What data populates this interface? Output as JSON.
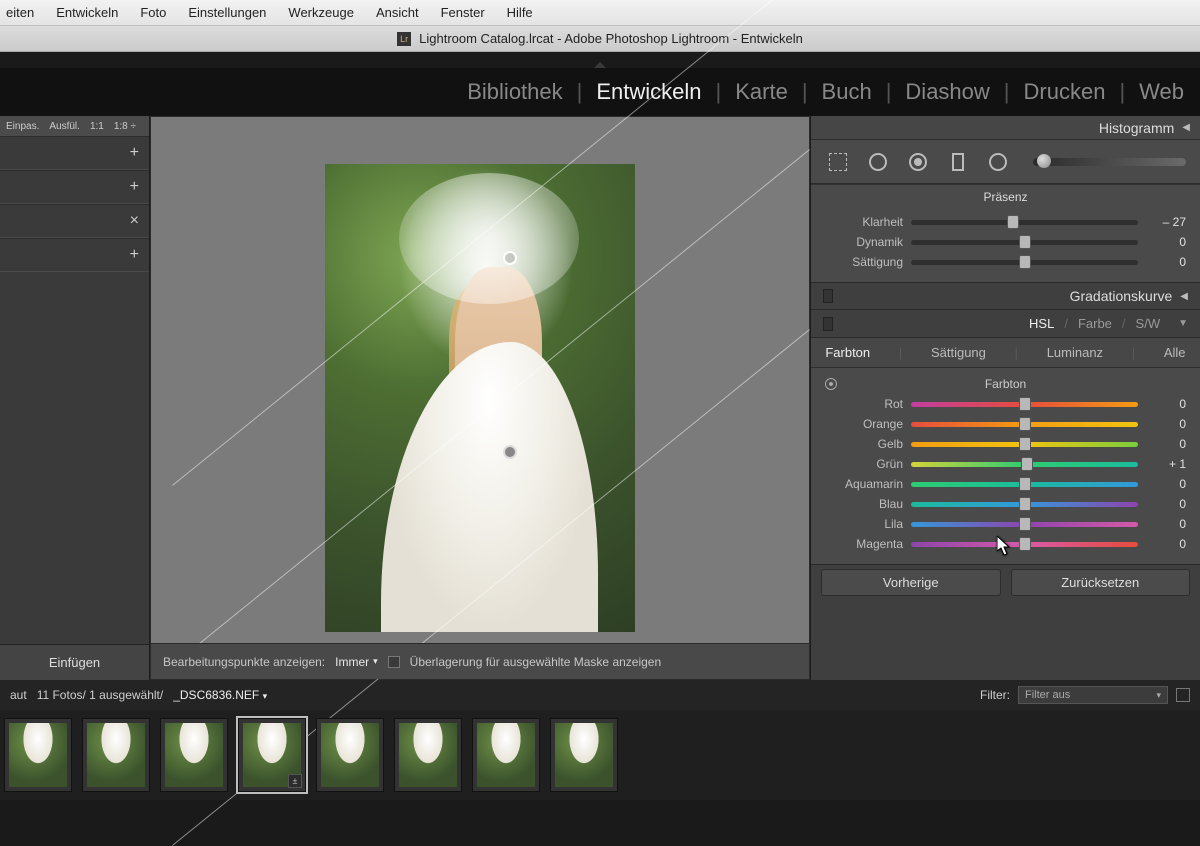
{
  "menubar": [
    "eiten",
    "Entwickeln",
    "Foto",
    "Einstellungen",
    "Werkzeuge",
    "Ansicht",
    "Fenster",
    "Hilfe"
  ],
  "window_title": "Lightroom Catalog.lrcat - Adobe Photoshop Lightroom - Entwickeln",
  "modules": {
    "items": [
      "Bibliothek",
      "Entwickeln",
      "Karte",
      "Buch",
      "Diashow",
      "Drucken",
      "Web"
    ],
    "active": "Entwickeln"
  },
  "leftpanel": {
    "top": [
      "Einpas.",
      "Ausfül.",
      "1:1",
      "1:8 ÷"
    ],
    "buttons": [
      "+",
      "+",
      "×",
      "+"
    ],
    "insert": "Einfügen"
  },
  "center_bottom": {
    "label": "Bearbeitungspunkte anzeigen:",
    "dropdown": "Immer",
    "mask": "Überlagerung für ausgewählte Maske anzeigen"
  },
  "rightpanel": {
    "histogram": "Histogramm",
    "presence": {
      "title": "Präsenz",
      "sliders": [
        {
          "label": "Klarheit",
          "value": "– 27",
          "pos": 45
        },
        {
          "label": "Dynamik",
          "value": "0",
          "pos": 50
        },
        {
          "label": "Sättigung",
          "value": "0",
          "pos": 50
        }
      ]
    },
    "tone_curve": "Gradationskurve",
    "hsl": {
      "tabs": [
        "HSL",
        "Farbe",
        "S/W"
      ],
      "active": "HSL",
      "subtabs": [
        "Farbton",
        "Sättigung",
        "Luminanz",
        "Alle"
      ],
      "sub_active": "Farbton",
      "section": "Farbton",
      "rows": [
        {
          "label": "Rot",
          "value": "0",
          "pos": 50,
          "grad": [
            "#c23ea0",
            "#e74c3c",
            "#f39c12"
          ]
        },
        {
          "label": "Orange",
          "value": "0",
          "pos": 50,
          "grad": [
            "#e74c3c",
            "#f39c12",
            "#f1c40f"
          ]
        },
        {
          "label": "Gelb",
          "value": "0",
          "pos": 50,
          "grad": [
            "#f39c12",
            "#f1c40f",
            "#7bcf3e"
          ]
        },
        {
          "label": "Grün",
          "value": "+ 1",
          "pos": 51,
          "grad": [
            "#d4d43a",
            "#2ecc71",
            "#1abc9c"
          ]
        },
        {
          "label": "Aquamarin",
          "value": "0",
          "pos": 50,
          "grad": [
            "#2ecc71",
            "#1abc9c",
            "#3498db"
          ]
        },
        {
          "label": "Blau",
          "value": "0",
          "pos": 50,
          "grad": [
            "#1abc9c",
            "#3498db",
            "#8e44ad"
          ]
        },
        {
          "label": "Lila",
          "value": "0",
          "pos": 50,
          "grad": [
            "#3498db",
            "#8e44ad",
            "#d65aa8"
          ]
        },
        {
          "label": "Magenta",
          "value": "0",
          "pos": 50,
          "grad": [
            "#8e44ad",
            "#d65aa8",
            "#e74c3c"
          ]
        }
      ]
    },
    "buttons": {
      "prev": "Vorherige",
      "reset": "Zurücksetzen"
    }
  },
  "infobar": {
    "text_left": "aut",
    "count": "11 Fotos/ 1 ausgewählt/",
    "file": "_DSC6836.NEF",
    "filter_label": "Filter:",
    "filter_value": "Filter aus"
  },
  "filmstrip": {
    "count": 8,
    "selected": 3
  }
}
